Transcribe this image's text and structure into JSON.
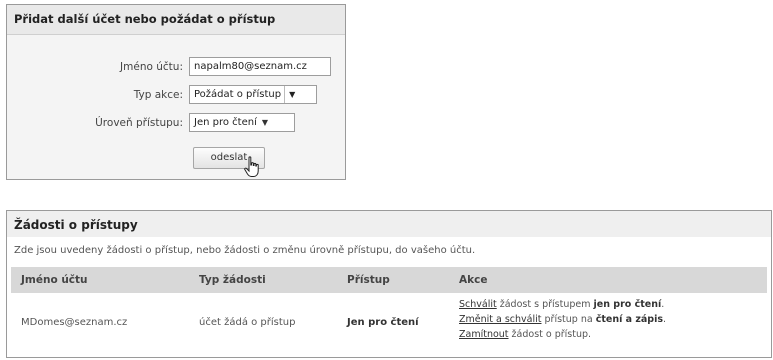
{
  "form": {
    "title": "Přidat další účet nebo požádat o přístup",
    "account_name_label": "Jméno účtu:",
    "account_name_value": "napalm80@seznam.cz",
    "action_type_label": "Typ akce:",
    "action_type_value": "Požádat o přístup",
    "access_level_label": "Úroveň přístupu:",
    "access_level_value": "Jen pro čtení",
    "submit_label": "odeslat"
  },
  "requests": {
    "title": "Žádosti o přístupy",
    "description": "Zde jsou uvedeny žádosti o přístup, nebo žádosti o změnu úrovně přístupu, do vašeho účtu.",
    "columns": {
      "account": "Jméno účtu",
      "request_type": "Typ žádosti",
      "access": "Přístup",
      "actions": "Akce"
    },
    "rows": [
      {
        "account": "MDomes@seznam.cz",
        "request_type": "účet žádá o přístup",
        "access": "Jen pro čtení",
        "action1_link": "Schválit",
        "action1_text": " žádost s přístupem ",
        "action1_strong": "jen pro čtení",
        "action1_end": ".",
        "action2_link": "Změnit a schválit",
        "action2_text": " přístup na ",
        "action2_strong": "čtení a zápis",
        "action2_end": ".",
        "action3_link": "Zamítnout",
        "action3_text": " žádost o přístup."
      }
    ]
  },
  "colors": {
    "panel_border": "#9a9a9a",
    "header_bg": "#e9e9e9",
    "table_head_bg": "#d8d8d8"
  },
  "icons": {
    "select_arrow": "dropdown-arrow-icon",
    "cursor": "hand-pointer-icon"
  }
}
